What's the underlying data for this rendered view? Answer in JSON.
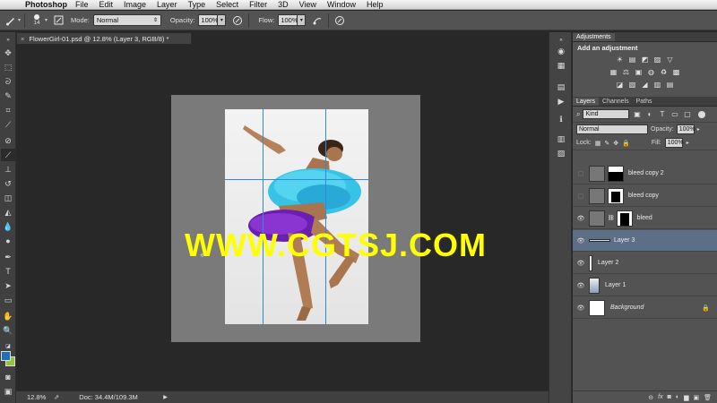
{
  "menubar": {
    "apple": "",
    "app_name": "Photoshop",
    "items": [
      "File",
      "Edit",
      "Image",
      "Layer",
      "Type",
      "Select",
      "Filter",
      "3D",
      "View",
      "Window",
      "Help"
    ]
  },
  "options_bar": {
    "brush_size": "14",
    "mode_label": "Mode:",
    "mode_value": "Normal",
    "opacity_label": "Opacity:",
    "opacity_value": "100%",
    "flow_label": "Flow:",
    "flow_value": "100%"
  },
  "document": {
    "tab_title": "FlowerGirl-01.psd @ 12.8% (Layer 3, RGB/8) *",
    "tab_close": "×"
  },
  "canvas": {
    "watermark": "WWW.CGTSJ.COM",
    "crosshair": "⌖"
  },
  "status": {
    "zoom": "12.8%",
    "doc_info": "Doc: 34.4M/109.3M"
  },
  "adjustments": {
    "tab": "Adjustments",
    "title": "Add an adjustment",
    "row1": [
      "☀",
      "▤",
      "◩",
      "▨",
      "▽"
    ],
    "row2": [
      "▦",
      "⚖",
      "▣",
      "◍",
      "♻",
      "▩"
    ],
    "row3": [
      "◪",
      "▧",
      "◢",
      "▥",
      "▤"
    ]
  },
  "layers_panel": {
    "tabs": [
      "Layers",
      "Channels",
      "Paths"
    ],
    "filter_kind": "Kind",
    "blend_mode": "Normal",
    "opacity_label": "Opacity:",
    "opacity_value": "100%",
    "lock_label": "Lock:",
    "fill_label": "Fill:",
    "fill_value": "100%",
    "layers": [
      {
        "name": "bleed copy 2",
        "visible": false
      },
      {
        "name": "bleed copy",
        "visible": false
      },
      {
        "name": "bleed",
        "visible": true
      },
      {
        "name": "Layer 3",
        "visible": true,
        "selected": true
      },
      {
        "name": "Layer 2",
        "visible": true
      },
      {
        "name": "Layer 1",
        "visible": true
      },
      {
        "name": "Background",
        "visible": true,
        "locked": true
      }
    ],
    "footer_icons": [
      "link-icon",
      "fx-icon",
      "mask-icon",
      "adjustment-icon",
      "group-icon",
      "new-layer-icon",
      "trash-icon"
    ],
    "footer_glyphs": [
      "⊖",
      "fx",
      "◙",
      "◐",
      "▆",
      "▣",
      "🗑"
    ]
  },
  "colors": {
    "foreground": "#1e6fb5",
    "background": "#8fc63c",
    "guide": "#2f8bd9",
    "watermark": "#ffff00",
    "selected_layer": "#5c6f87"
  }
}
